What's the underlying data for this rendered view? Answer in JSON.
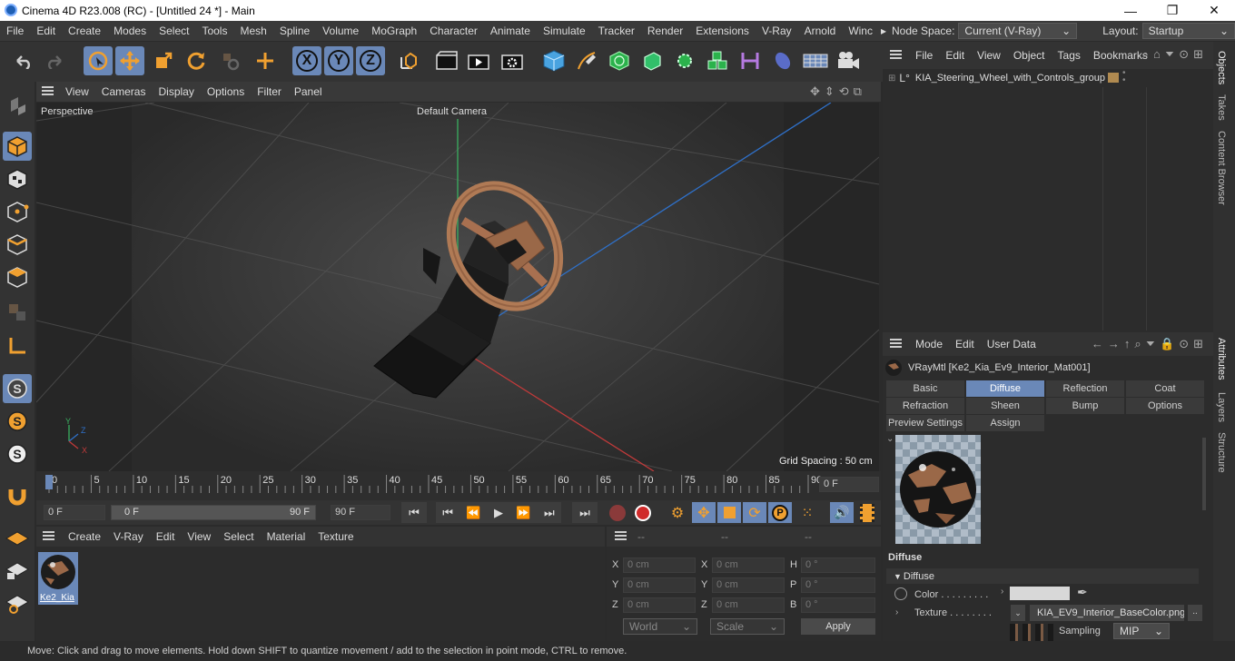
{
  "window": {
    "title": "Cinema 4D R23.008 (RC) - [Untitled 24 *] - Main",
    "min": "—",
    "max": "❐",
    "close": "✕"
  },
  "menu": [
    "File",
    "Edit",
    "Create",
    "Modes",
    "Select",
    "Tools",
    "Mesh",
    "Spline",
    "Volume",
    "MoGraph",
    "Character",
    "Animate",
    "Simulate",
    "Tracker",
    "Render",
    "Extensions",
    "V-Ray",
    "Arnold",
    "Winc"
  ],
  "node_space": {
    "label": "Node Space:",
    "value": "Current (V-Ray)"
  },
  "layout": {
    "label": "Layout:",
    "value": "Startup"
  },
  "toolbar": {
    "x": "X",
    "y": "Y",
    "z": "Z"
  },
  "viewport": {
    "menu": [
      "View",
      "Cameras",
      "Display",
      "Options",
      "Filter",
      "Panel"
    ],
    "projection": "Perspective",
    "camera": "Default Camera",
    "grid_spacing": "Grid Spacing : 50 cm",
    "axis_y": "Y",
    "axis_z": "Z",
    "axis_x": "X"
  },
  "timeline": {
    "ticks": [
      "0",
      "5",
      "10",
      "15",
      "20",
      "25",
      "30",
      "35",
      "40",
      "45",
      "50",
      "55",
      "60",
      "65",
      "70",
      "75",
      "80",
      "85",
      "90"
    ],
    "current_frame": "0 F"
  },
  "transport": {
    "start": "0 F",
    "range_start": "0 F",
    "range_end": "90 F",
    "end": "90 F"
  },
  "material_manager": {
    "menu": [
      "Create",
      "V-Ray",
      "Edit",
      "View",
      "Select",
      "Material",
      "Texture"
    ],
    "material_name": "Ke2_Kia"
  },
  "coordinates": {
    "header": [
      "--",
      "--",
      "--"
    ],
    "rows": [
      {
        "a": "X",
        "av": "0 cm",
        "b": "X",
        "bv": "0 cm",
        "c": "H",
        "cv": "0 °"
      },
      {
        "a": "Y",
        "av": "0 cm",
        "b": "Y",
        "bv": "0 cm",
        "c": "P",
        "cv": "0 °"
      },
      {
        "a": "Z",
        "av": "0 cm",
        "b": "Z",
        "bv": "0 cm",
        "c": "B",
        "cv": "0 °"
      }
    ],
    "world": "World",
    "scale": "Scale",
    "apply": "Apply"
  },
  "objects": {
    "menu": [
      "File",
      "Edit",
      "View",
      "Object",
      "Tags",
      "Bookmarks"
    ],
    "items": [
      {
        "name": "KIA_Steering_Wheel_with_Controls_group"
      }
    ]
  },
  "attributes": {
    "menu": [
      "Mode",
      "Edit",
      "User Data"
    ],
    "material_title": "VRayMtl [Ke2_Kia_Ev9_Interior_Mat001]",
    "tabs": [
      "Basic",
      "Diffuse",
      "Reflection",
      "Coat",
      "Refraction",
      "Sheen",
      "Bump",
      "Options",
      "Preview Settings",
      "Assign"
    ],
    "selected_tab": "Diffuse",
    "section": "Diffuse",
    "group": "Diffuse",
    "color_label": "Color . . . . . . . . .",
    "texture_label": "Texture . . . . . . . .",
    "texture_file": "KIA_EV9_Interior_BaseColor.png",
    "sampling_label": "Sampling",
    "sampling_value": "MIP"
  },
  "side_tabs": [
    "Objects",
    "Takes",
    "Content Browser",
    "Attributes",
    "Layers",
    "Structure"
  ],
  "status": "Move: Click and drag to move elements. Hold down SHIFT to quantize movement / add to the selection in point mode, CTRL to remove.",
  "colors": {
    "accent": "#6a88b8",
    "orange": "#f0a030",
    "wheel": "#b07a55"
  }
}
